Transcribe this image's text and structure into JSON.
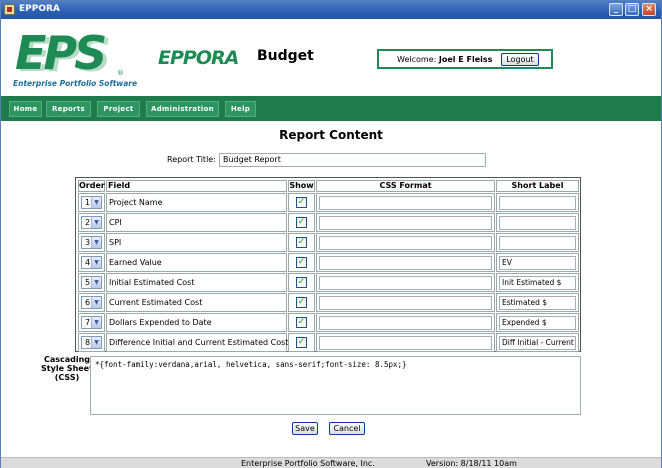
{
  "window": {
    "title": "EPPORA"
  },
  "header": {
    "logo_text": "EPS",
    "logo_reg": "®",
    "logo_tagline": "Enterprise Portfolio Software",
    "product": "EPPORA",
    "module": "Budget",
    "welcome_label": "Welcome:",
    "user_name": "Joel E Fleiss",
    "logout_label": "Logout"
  },
  "nav": [
    "Home",
    "Reports",
    "Project",
    "Administration",
    "Help"
  ],
  "page_title": "Report Content",
  "report_title_label": "Report Title:",
  "report_title_value": "Budget Report",
  "table": {
    "headers": {
      "order": "Order",
      "field": "Field",
      "show": "Show",
      "css": "CSS Format",
      "short": "Short Label"
    },
    "rows": [
      {
        "order": "1",
        "field": "Project Name",
        "show": true,
        "css": "",
        "short": ""
      },
      {
        "order": "2",
        "field": "CPI",
        "show": true,
        "css": "",
        "short": ""
      },
      {
        "order": "3",
        "field": "SPI",
        "show": true,
        "css": "",
        "short": ""
      },
      {
        "order": "4",
        "field": "Earned Value",
        "show": true,
        "css": "",
        "short": "EV"
      },
      {
        "order": "5",
        "field": "Initial Estimated Cost",
        "show": true,
        "css": "",
        "short": "Init Estimated $"
      },
      {
        "order": "6",
        "field": "Current Estimated Cost",
        "show": true,
        "css": "",
        "short": "Estimated $"
      },
      {
        "order": "7",
        "field": "Dollars Expended to Date",
        "show": true,
        "css": "",
        "short": "Expended $"
      },
      {
        "order": "8",
        "field": "Difference Initial and Current Estimated Cost",
        "show": true,
        "css": "",
        "short": "Diff Initial - Current"
      }
    ]
  },
  "css_section": {
    "label": "Cascading Style Sheet (CSS)",
    "value": "*{font-family:verdana,arial, helvetica, sans-serif;font-size: 8.5px;}"
  },
  "buttons": {
    "save": "Save",
    "cancel": "Cancel"
  },
  "footer": {
    "company": "Enterprise Portfolio Software, Inc.",
    "version": "Version: 8/18/11 10am"
  },
  "colors": {
    "brand_green": "#1e8a54",
    "nav_green": "#1f7a4d",
    "titlebar_blue": "#2b5fb0"
  }
}
